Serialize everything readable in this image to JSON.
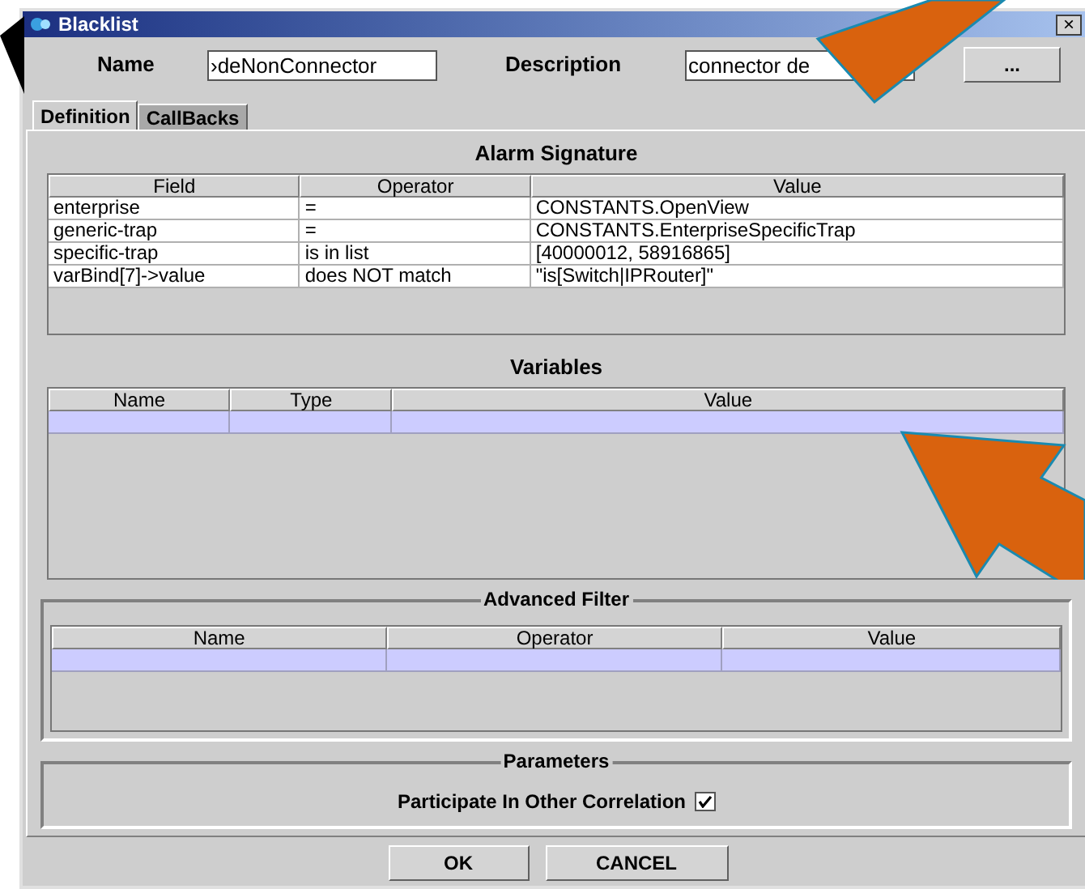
{
  "window": {
    "title": "Blacklist",
    "close": "×"
  },
  "fields": [
    {
      "label": "Name",
      "value": "›deNonConnector"
    },
    {
      "label": "Description",
      "value": "connector de"
    }
  ],
  "more_button": "...",
  "tabs": [
    {
      "label": "Definition",
      "selected": true
    },
    {
      "label": "CallBacks",
      "selected": false
    }
  ],
  "alarm_signature": {
    "title": "Alarm Signature",
    "columns": [
      "Field",
      "Operator",
      "Value"
    ],
    "rows": [
      {
        "cells": [
          "enterprise",
          "=",
          "CONSTANTS.OpenView"
        ],
        "selected": false
      },
      {
        "cells": [
          "generic-trap",
          "=",
          "CONSTANTS.EnterpriseSpecificTrap"
        ],
        "selected": false
      },
      {
        "cells": [
          "specific-trap",
          "is in list",
          "[40000012, 58916865]"
        ],
        "selected": false
      },
      {
        "cells": [
          "varBind[7]->value",
          "does NOT match",
          "\"is[Switch|IPRouter]\""
        ],
        "selected": false
      }
    ]
  },
  "variables": {
    "title": "Variables",
    "columns": [
      "Name",
      "Type",
      "Value"
    ],
    "rows": [
      {
        "selected": true
      }
    ]
  },
  "advanced_filter": {
    "title": "Advanced Filter",
    "columns": [
      "Name",
      "Operator",
      "Value"
    ],
    "rows": [
      {
        "selected": true
      }
    ]
  },
  "parameters": {
    "title": "Parameters",
    "option": {
      "label": "Participate In Other Correlation",
      "checked": true
    }
  },
  "buttons": [
    "OK",
    "CANCEL"
  ]
}
